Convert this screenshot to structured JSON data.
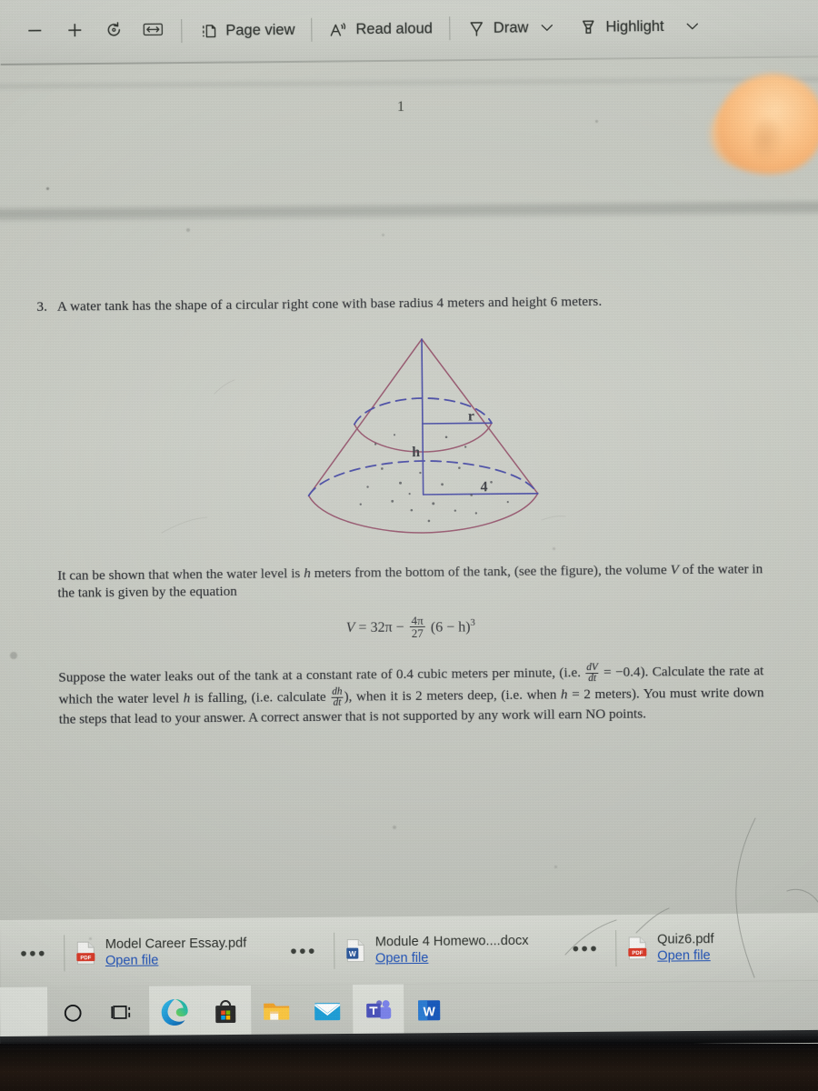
{
  "app": {
    "name": "Microsoft Edge PDF viewer",
    "page_number": "1"
  },
  "toolbar": {
    "zoom_out_label": "−",
    "zoom_in_label": "+",
    "rotate_icon": "rotate-icon",
    "fit_icon": "fit-to-width-icon",
    "page_view_label": "Page view",
    "read_aloud_label": "Read aloud",
    "draw_label": "Draw",
    "highlight_label": "Highlight",
    "chevron": "⌄"
  },
  "document": {
    "question_number": "3.",
    "question_text": "A water tank has the shape of a circular right cone with base radius 4 meters and height 6 meters.",
    "paragraph1_part1": "It can be shown that when the water level is ",
    "paragraph1_h": "h",
    "paragraph1_part2": " meters from the bottom of the tank, (see the figure), the volume ",
    "paragraph1_V": "V",
    "paragraph1_part3": " of the water in the tank is given by the equation",
    "equation": {
      "lhs": "V",
      "equals": "=",
      "term1": "32π",
      "minus": "−",
      "frac_num": "4π",
      "frac_den": "27",
      "factor": "(6 − h)",
      "exponent": "3",
      "plain": "V = 32π − (4π/27)(6 − h)³"
    },
    "paragraph2_a": "Suppose the water leaks out of the tank at a constant rate of 0.4 cubic meters per minute, (i.e. ",
    "paragraph2_dv_num": "dV",
    "paragraph2_dv_den": "dt",
    "paragraph2_b": " = −0.4). Calculate the rate at which the water level ",
    "paragraph2_h": "h",
    "paragraph2_c": " is falling, (i.e. calculate ",
    "paragraph2_dh_num": "dh",
    "paragraph2_dh_den": "dt",
    "paragraph2_d": "), when it is 2 meters deep, (i.e. when ",
    "paragraph2_h2": "h",
    "paragraph2_e": " = 2 meters). You must write down the steps that lead to your answer. A correct answer that is not supported by any work will earn NO points."
  },
  "figure": {
    "name": "inverted-cone-diagram",
    "label_r": "r",
    "label_h": "h",
    "label_radius": "4",
    "cone_color": "#8e4a63",
    "annotation_color": "#3b3f9e"
  },
  "downloads": [
    {
      "ellipsis": "•••",
      "icon": "pdf-file-icon",
      "filename": "Model Career Essay.pdf",
      "action": "Open file"
    },
    {
      "ellipsis": "•••",
      "icon": "word-file-icon",
      "filename": "Module 4 Homewo....docx",
      "action": "Open file"
    },
    {
      "ellipsis": "•••",
      "icon": "pdf-file-icon",
      "filename": "Quiz6.pdf",
      "action": "Open file"
    }
  ],
  "taskbar": {
    "items": [
      {
        "name": "search-icon",
        "label": "Search"
      },
      {
        "name": "task-view-icon",
        "label": "Task view"
      },
      {
        "name": "edge-icon",
        "label": "Microsoft Edge"
      },
      {
        "name": "microsoft-store-icon",
        "label": "Microsoft Store"
      },
      {
        "name": "file-explorer-icon",
        "label": "File Explorer"
      },
      {
        "name": "mail-icon",
        "label": "Mail"
      },
      {
        "name": "teams-icon",
        "label": "Microsoft Teams"
      },
      {
        "name": "word-icon",
        "label": "Microsoft Word"
      }
    ]
  },
  "colors": {
    "screen_bg": "#c4c7bf",
    "toolbar_bg": "#cbcec7",
    "link_blue": "#1f51b5",
    "taskbar_accent": "#1f6fd0",
    "pdf_red": "#d83b2a",
    "word_blue": "#2b579a"
  }
}
